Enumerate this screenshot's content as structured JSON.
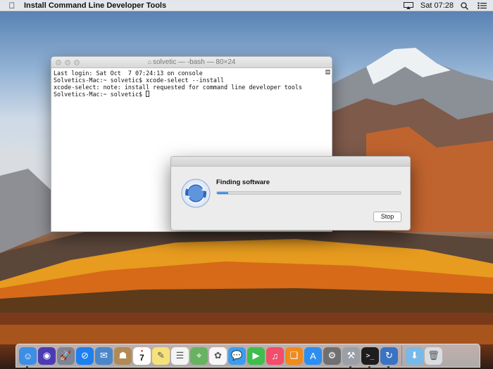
{
  "menubar": {
    "apple_icon": "apple-logo-icon",
    "app_title": "Install Command Line Developer Tools",
    "icons": [
      "airplay-display-icon",
      "spotlight-search-icon",
      "notification-center-icon"
    ],
    "clock": "Sat 07:28"
  },
  "terminal": {
    "title": "solvetic — -bash — 80×24",
    "lines": [
      "Last login: Sat Oct  7 07:24:13 on console",
      "Solvetics-Mac:~ solvetic$ xcode-select --install",
      "xcode-select: note: install requested for command line developer tools",
      "Solvetics-Mac:~ solvetic$ "
    ]
  },
  "dialog": {
    "status": "Finding software",
    "progress": 0.06,
    "stop_label": "Stop",
    "icon": "software-update-icon"
  },
  "dock": {
    "items": [
      {
        "name": "finder-icon",
        "color": "#3c8ee6",
        "glyph": "☺",
        "running": true
      },
      {
        "name": "siri-icon",
        "color": "#4a3bb5",
        "glyph": "◉",
        "running": false
      },
      {
        "name": "launchpad-icon",
        "color": "#7d8594",
        "glyph": "🚀",
        "running": false
      },
      {
        "name": "safari-icon",
        "color": "#1d7ff0",
        "glyph": "⊘",
        "running": false
      },
      {
        "name": "mail-icon",
        "color": "#4a87c9",
        "glyph": "✉",
        "running": false
      },
      {
        "name": "contacts-icon",
        "color": "#b28a55",
        "glyph": "☗",
        "running": false
      },
      {
        "name": "calendar-icon",
        "color": "#ffffff",
        "glyph": "7",
        "running": false
      },
      {
        "name": "notes-icon",
        "color": "#f6e27a",
        "glyph": "✎",
        "running": false
      },
      {
        "name": "reminders-icon",
        "color": "#f4f4f4",
        "glyph": "☰",
        "running": false
      },
      {
        "name": "maps-icon",
        "color": "#68b361",
        "glyph": "⌖",
        "running": false
      },
      {
        "name": "photos-icon",
        "color": "#f7f7f7",
        "glyph": "✿",
        "running": false
      },
      {
        "name": "messages-icon",
        "color": "#3a9df0",
        "glyph": "💬",
        "running": false
      },
      {
        "name": "facetime-icon",
        "color": "#3fbe4d",
        "glyph": "▶",
        "running": false
      },
      {
        "name": "itunes-icon",
        "color": "#f24d6b",
        "glyph": "♫",
        "running": false
      },
      {
        "name": "ibooks-icon",
        "color": "#f08a1c",
        "glyph": "❑",
        "running": false
      },
      {
        "name": "app-store-icon",
        "color": "#2c8ef0",
        "glyph": "A",
        "running": false
      },
      {
        "name": "system-preferences-icon",
        "color": "#707070",
        "glyph": "⚙",
        "running": false
      },
      {
        "name": "utilities-icon",
        "color": "#9ba0a7",
        "glyph": "⚒",
        "running": true
      },
      {
        "name": "terminal-icon",
        "color": "#1d1d1d",
        "glyph": ">_",
        "running": true
      },
      {
        "name": "software-update-icon",
        "color": "#3b73c4",
        "glyph": "↻",
        "running": true
      }
    ],
    "trailing": [
      {
        "name": "downloads-folder-icon",
        "color": "#78b9e8",
        "glyph": "⬇"
      },
      {
        "name": "trash-icon",
        "color": "#d8dde2",
        "glyph": "🗑"
      }
    ]
  }
}
